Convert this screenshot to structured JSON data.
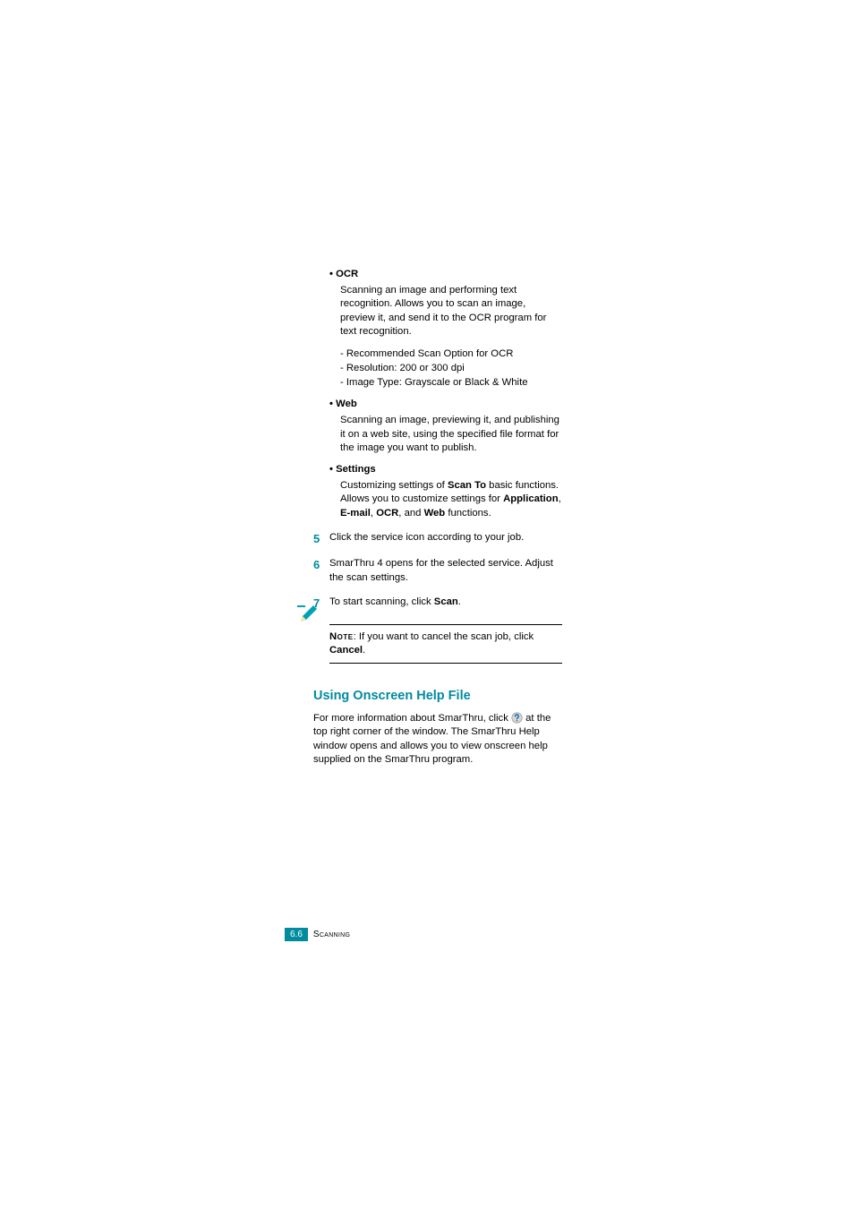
{
  "bullets": {
    "ocr": {
      "label": "OCR",
      "desc": "Scanning an image and performing text recognition. Allows you to scan an image, preview it, and send it to the OCR program for text recognition.",
      "sub1": "- Recommended Scan Option for OCR",
      "sub2": "- Resolution: 200 or 300 dpi",
      "sub3": "- Image Type: Grayscale or Black & White"
    },
    "web": {
      "label": "Web",
      "desc": "Scanning an image, previewing it, and publishing it on a web site, using the specified file format for the image you want to publish."
    },
    "settings": {
      "label": "Settings",
      "desc_pre": "Customizing settings of ",
      "scan_to": "Scan To",
      "desc_mid": " basic functions. Allows you to customize settings for ",
      "app": "Application",
      "comma1": ", ",
      "email": "E-mail",
      "comma2": ", ",
      "ocr": "OCR",
      "comma3": ", and ",
      "web": "Web",
      "desc_post": " functions."
    }
  },
  "steps": {
    "s5": {
      "num": "5",
      "text": "Click the service icon according to your job."
    },
    "s6": {
      "num": "6",
      "text": "SmarThru 4 opens for the selected service. Adjust the scan settings."
    },
    "s7": {
      "num": "7",
      "pre": "To start scanning, click ",
      "bold": "Scan",
      "post": "."
    }
  },
  "note": {
    "label": "Note",
    "pre": ": If you want to cancel the scan job, click ",
    "bold": "Cancel",
    "post": "."
  },
  "section": {
    "heading": "Using Onscreen Help File",
    "para_pre": "For more information about SmarThru, click ",
    "para_post": " at the top right corner of the window. The SmarThru Help window opens and allows you to view onscreen help supplied on the SmarThru program."
  },
  "footer": {
    "page": "6.6",
    "chapter": "Scanning"
  }
}
